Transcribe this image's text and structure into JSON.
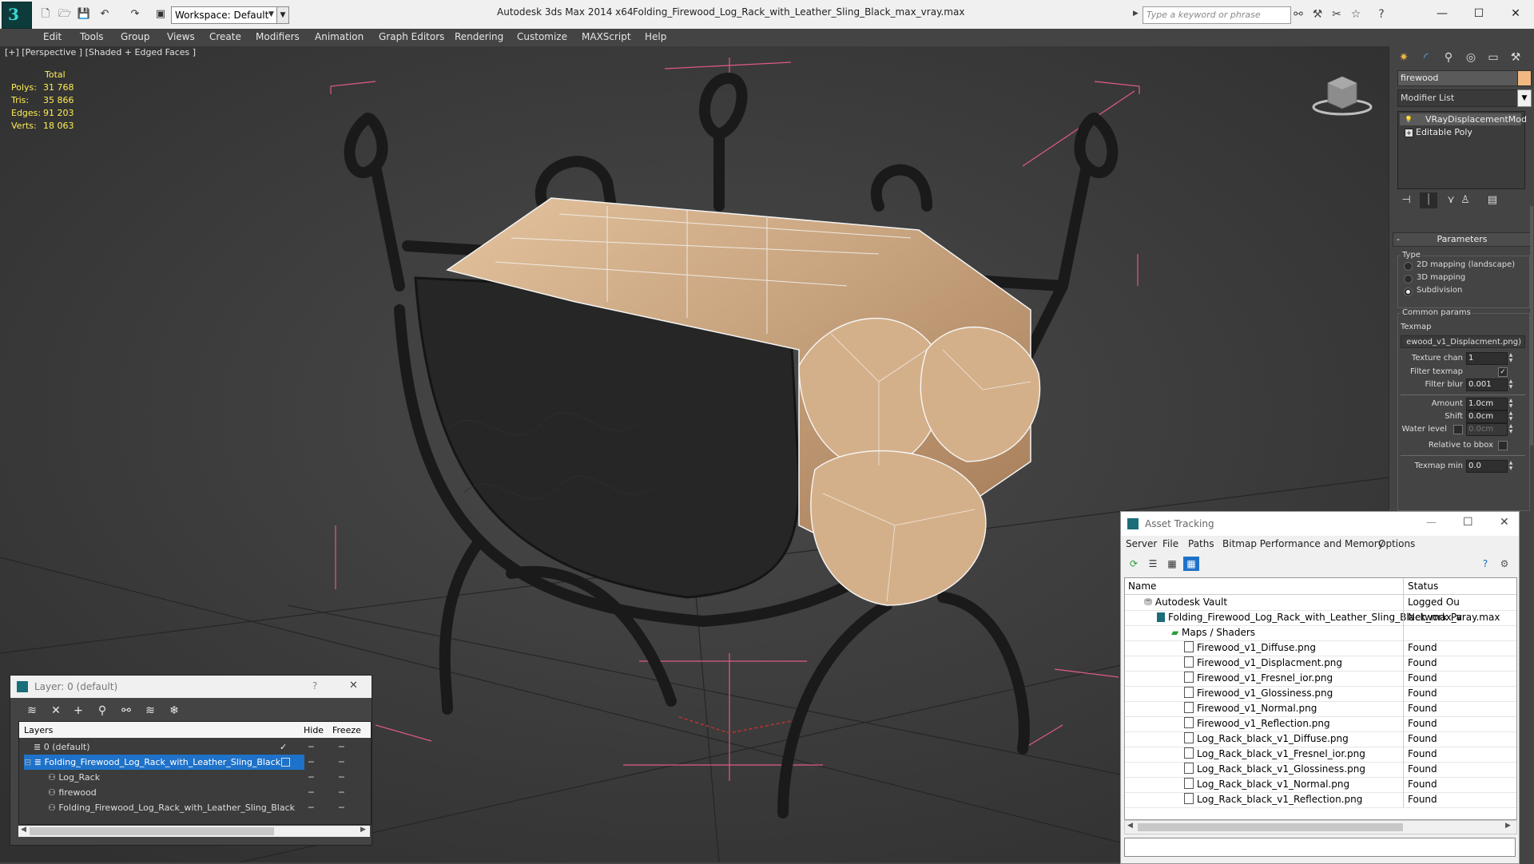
{
  "titlebar": {
    "app_name": "Autodesk 3ds Max  2014 x64",
    "document": "Folding_Firewood_Log_Rack_with_Leather_Sling_Black_max_vray.max",
    "workspace": "Workspace: Default",
    "search_placeholder": "Type a keyword or phrase",
    "win_minimize": "—",
    "win_maximize": "☐",
    "win_close": "✕"
  },
  "menu": [
    "Edit",
    "Tools",
    "Group",
    "Views",
    "Create",
    "Modifiers",
    "Animation",
    "Graph Editors",
    "Rendering",
    "Customize",
    "MAXScript",
    "Help"
  ],
  "viewport": {
    "label": "[+] [Perspective ] [Shaded + Edged Faces ]",
    "stats": {
      "total_label": "Total",
      "rows": [
        {
          "label": "Polys:",
          "value": "31 768"
        },
        {
          "label": "Tris:",
          "value": "35 866"
        },
        {
          "label": "Edges:",
          "value": "91 203"
        },
        {
          "label": "Verts:",
          "value": "18 063"
        }
      ]
    }
  },
  "command_panel": {
    "object_name": "firewood",
    "object_color": "#f2b882",
    "modifier_list": "Modifier List",
    "stack": [
      "VRayDisplacementMod",
      "Editable Poly"
    ],
    "parameters_title": "Parameters",
    "type_group": "Type",
    "type_options": [
      "2D mapping (landscape)",
      "3D mapping",
      "Subdivision"
    ],
    "type_selected": "Subdivision",
    "common_group": "Common params",
    "texmap_label": "Texmap",
    "texmap_value": "ewood_v1_Displacment.png)",
    "texture_chan_label": "Texture chan",
    "texture_chan_value": "1",
    "filter_texmap_label": "Filter texmap",
    "filter_blur_label": "Filter blur",
    "filter_blur_value": "0.001",
    "amount_label": "Amount",
    "amount_value": "1.0cm",
    "shift_label": "Shift",
    "shift_value": "0.0cm",
    "water_level_label": "Water level",
    "water_level_value": "0.0cm",
    "relative_label": "Relative to bbox",
    "texmap_min_label": "Texmap min",
    "texmap_min_value": "0.0"
  },
  "asset_tracking": {
    "title": "Asset Tracking",
    "menu": [
      "Server",
      "File",
      "Paths",
      "Bitmap Performance and Memory",
      "Options"
    ],
    "col_name": "Name",
    "col_status": "Status",
    "rows": [
      {
        "name": "Autodesk Vault",
        "status": "Logged Ou"
      },
      {
        "name": "Folding_Firewood_Log_Rack_with_Leather_Sling_Black_max_vray.max",
        "status": "Network Pa"
      },
      {
        "name": "Maps / Shaders",
        "status": ""
      },
      {
        "name": "Firewood_v1_Diffuse.png",
        "status": "Found"
      },
      {
        "name": "Firewood_v1_Displacment.png",
        "status": "Found"
      },
      {
        "name": "Firewood_v1_Fresnel_ior.png",
        "status": "Found"
      },
      {
        "name": "Firewood_v1_Glossiness.png",
        "status": "Found"
      },
      {
        "name": "Firewood_v1_Normal.png",
        "status": "Found"
      },
      {
        "name": "Firewood_v1_Reflection.png",
        "status": "Found"
      },
      {
        "name": "Log_Rack_black_v1_Diffuse.png",
        "status": "Found"
      },
      {
        "name": "Log_Rack_black_v1_Fresnel_ior.png",
        "status": "Found"
      },
      {
        "name": "Log_Rack_black_v1_Glossiness.png",
        "status": "Found"
      },
      {
        "name": "Log_Rack_black_v1_Normal.png",
        "status": "Found"
      },
      {
        "name": "Log_Rack_black_v1_Reflection.png",
        "status": "Found"
      }
    ]
  },
  "layer_dialog": {
    "title": "Layer: 0 (default)",
    "help": "?",
    "close": "✕",
    "col_layers": "Layers",
    "col_hide": "Hide",
    "col_freeze": "Freeze",
    "rows": [
      {
        "name": "0 (default)"
      },
      {
        "name": "Folding_Firewood_Log_Rack_with_Leather_Sling_Black"
      },
      {
        "name": "Log_Rack"
      },
      {
        "name": "firewood"
      },
      {
        "name": "Folding_Firewood_Log_Rack_with_Leather_Sling_Black"
      }
    ]
  }
}
